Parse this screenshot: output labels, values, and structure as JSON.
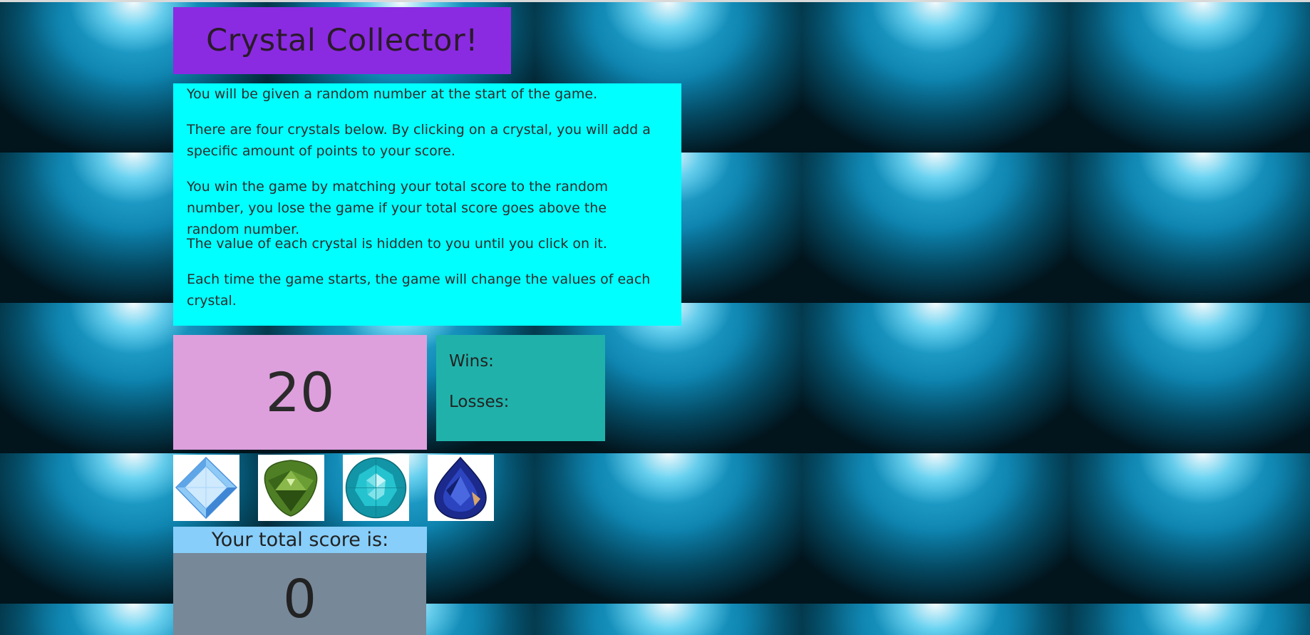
{
  "title": "Crystal Collector!",
  "instructions": [
    "You will be given a random number at the start of the game.",
    "There are four crystals below. By clicking on a crystal, you will add a specific amount of points to your score.",
    "You win the game by matching your total score to the random number, you lose the game if your total score goes above the random number.",
    "The value of each crystal is hidden to you until you click on it.",
    "Each time the game starts, the game will change the values of each crystal."
  ],
  "target_number": "20",
  "record": {
    "wins_label": "Wins:",
    "losses_label": "Losses:"
  },
  "crystals": [
    {
      "icon": "light-blue-square-crystal-icon",
      "color": "#6fb8f2"
    },
    {
      "icon": "green-trillion-crystal-icon",
      "color": "#5f8f2e"
    },
    {
      "icon": "teal-round-crystal-icon",
      "color": "#1aa8b8"
    },
    {
      "icon": "blue-pear-crystal-icon",
      "color": "#1e2f9a"
    }
  ],
  "score": {
    "label": "Your total score is:",
    "value": "0"
  },
  "colors": {
    "title_bg": "#8a2be2",
    "instructions_bg": "#00ffff",
    "target_bg": "#dda0dd",
    "record_bg": "#20b2aa",
    "score_label_bg": "#87cefa",
    "score_bg": "#778899"
  }
}
